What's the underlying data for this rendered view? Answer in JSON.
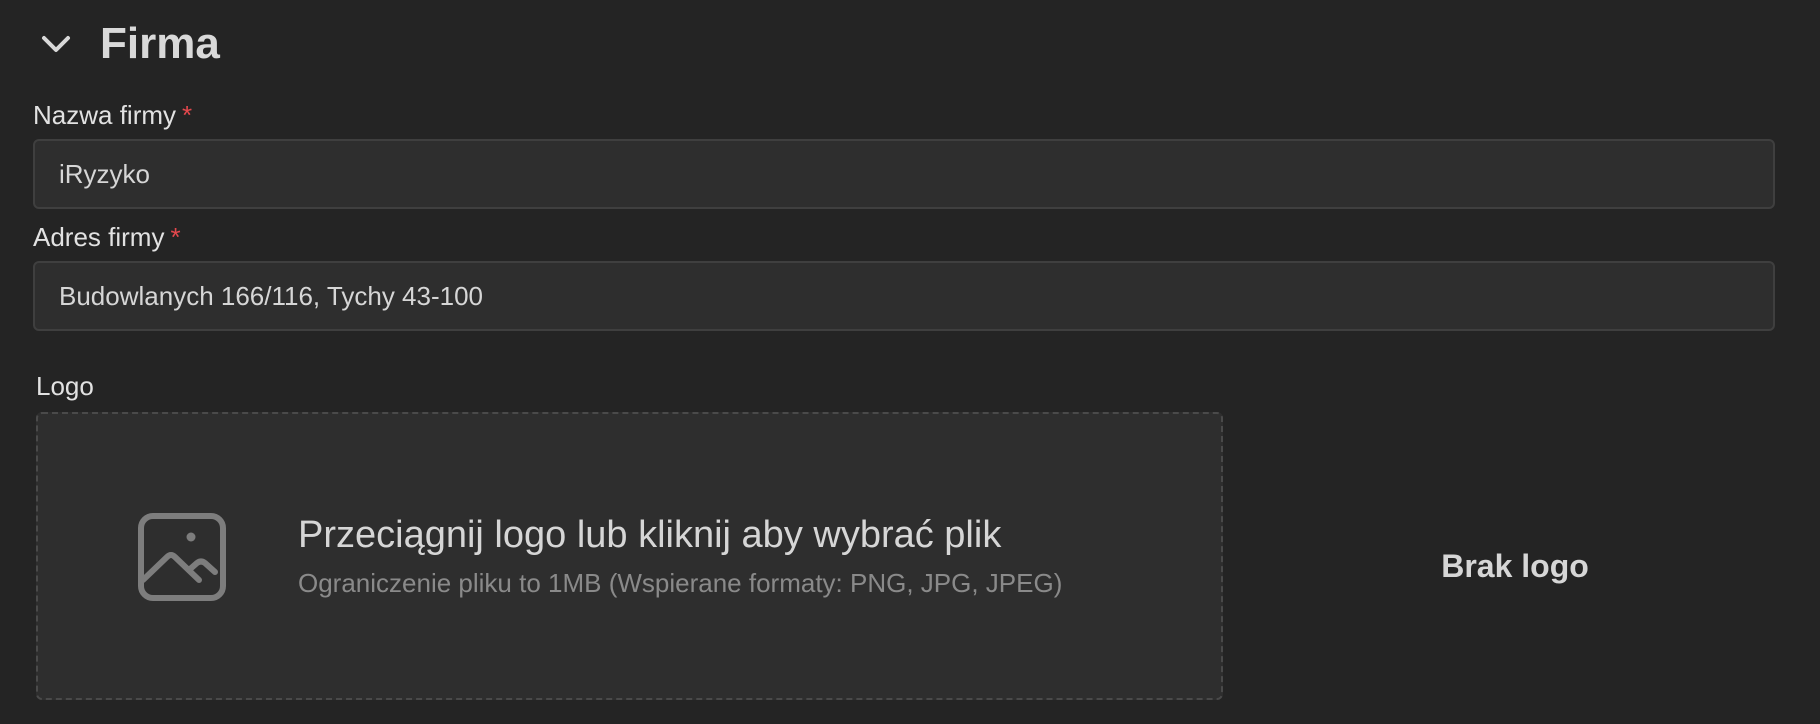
{
  "section": {
    "title": "Firma",
    "toggle_icon": "chevron-down-icon"
  },
  "fields": {
    "company_name": {
      "label": "Nazwa firmy",
      "required_mark": "*",
      "value": "iRyzyko"
    },
    "company_address": {
      "label": "Adres firmy",
      "required_mark": "*",
      "value": "Budowlanych 166/116, Tychy 43-100"
    }
  },
  "logo": {
    "label": "Logo",
    "dropzone_icon": "image-icon",
    "dropzone_title": "Przeciągnij logo lub kliknij aby wybrać plik",
    "dropzone_hint": "Ograniczenie pliku to 1MB (Wspierane formaty: PNG, JPG, JPEG)",
    "preview_empty": "Brak logo"
  },
  "colors": {
    "background": "#242424",
    "input_background": "#2e2e2e",
    "required": "#e5484d",
    "muted_text": "#8a8a8a"
  }
}
